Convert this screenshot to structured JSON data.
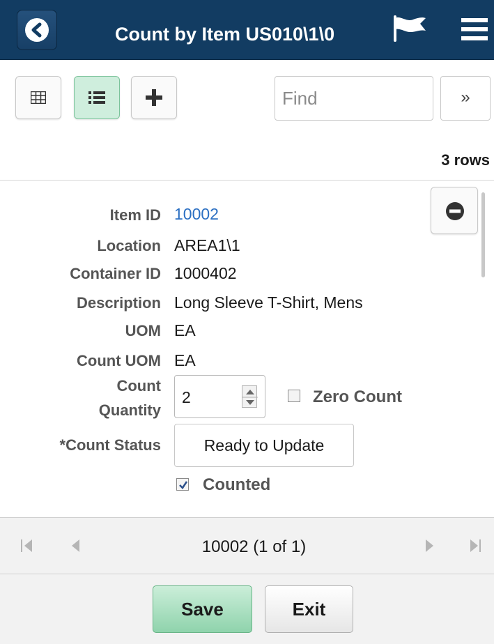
{
  "header": {
    "title": "Count by Item US010\\1\\0"
  },
  "toolbar": {
    "find_placeholder": "Find",
    "more_label": "»"
  },
  "grid": {
    "rows_label": "3 rows"
  },
  "detail": {
    "item_id_label": "Item ID",
    "item_id": "10002",
    "location_label": "Location",
    "location": "AREA1\\1",
    "container_label": "Container ID",
    "container": "1000402",
    "description_label": "Description",
    "description": "Long Sleeve T-Shirt, Mens",
    "uom_label": "UOM",
    "uom": "EA",
    "count_uom_label": "Count UOM",
    "count_uom": "EA",
    "count_qty_label_1": "Count",
    "count_qty_label_2": "Quantity",
    "count_qty": "2",
    "zero_count_label": "Zero Count",
    "zero_count_checked": false,
    "count_status_label": "*Count Status",
    "count_status": "Ready to Update",
    "counted_label": "Counted",
    "counted_checked": true
  },
  "pager": {
    "text": "10002 (1 of 1)"
  },
  "footer": {
    "save_label": "Save",
    "exit_label": "Exit"
  },
  "colors": {
    "header": "#123c62",
    "accent_green": "#cfeedd",
    "link": "#2b6fc2"
  }
}
